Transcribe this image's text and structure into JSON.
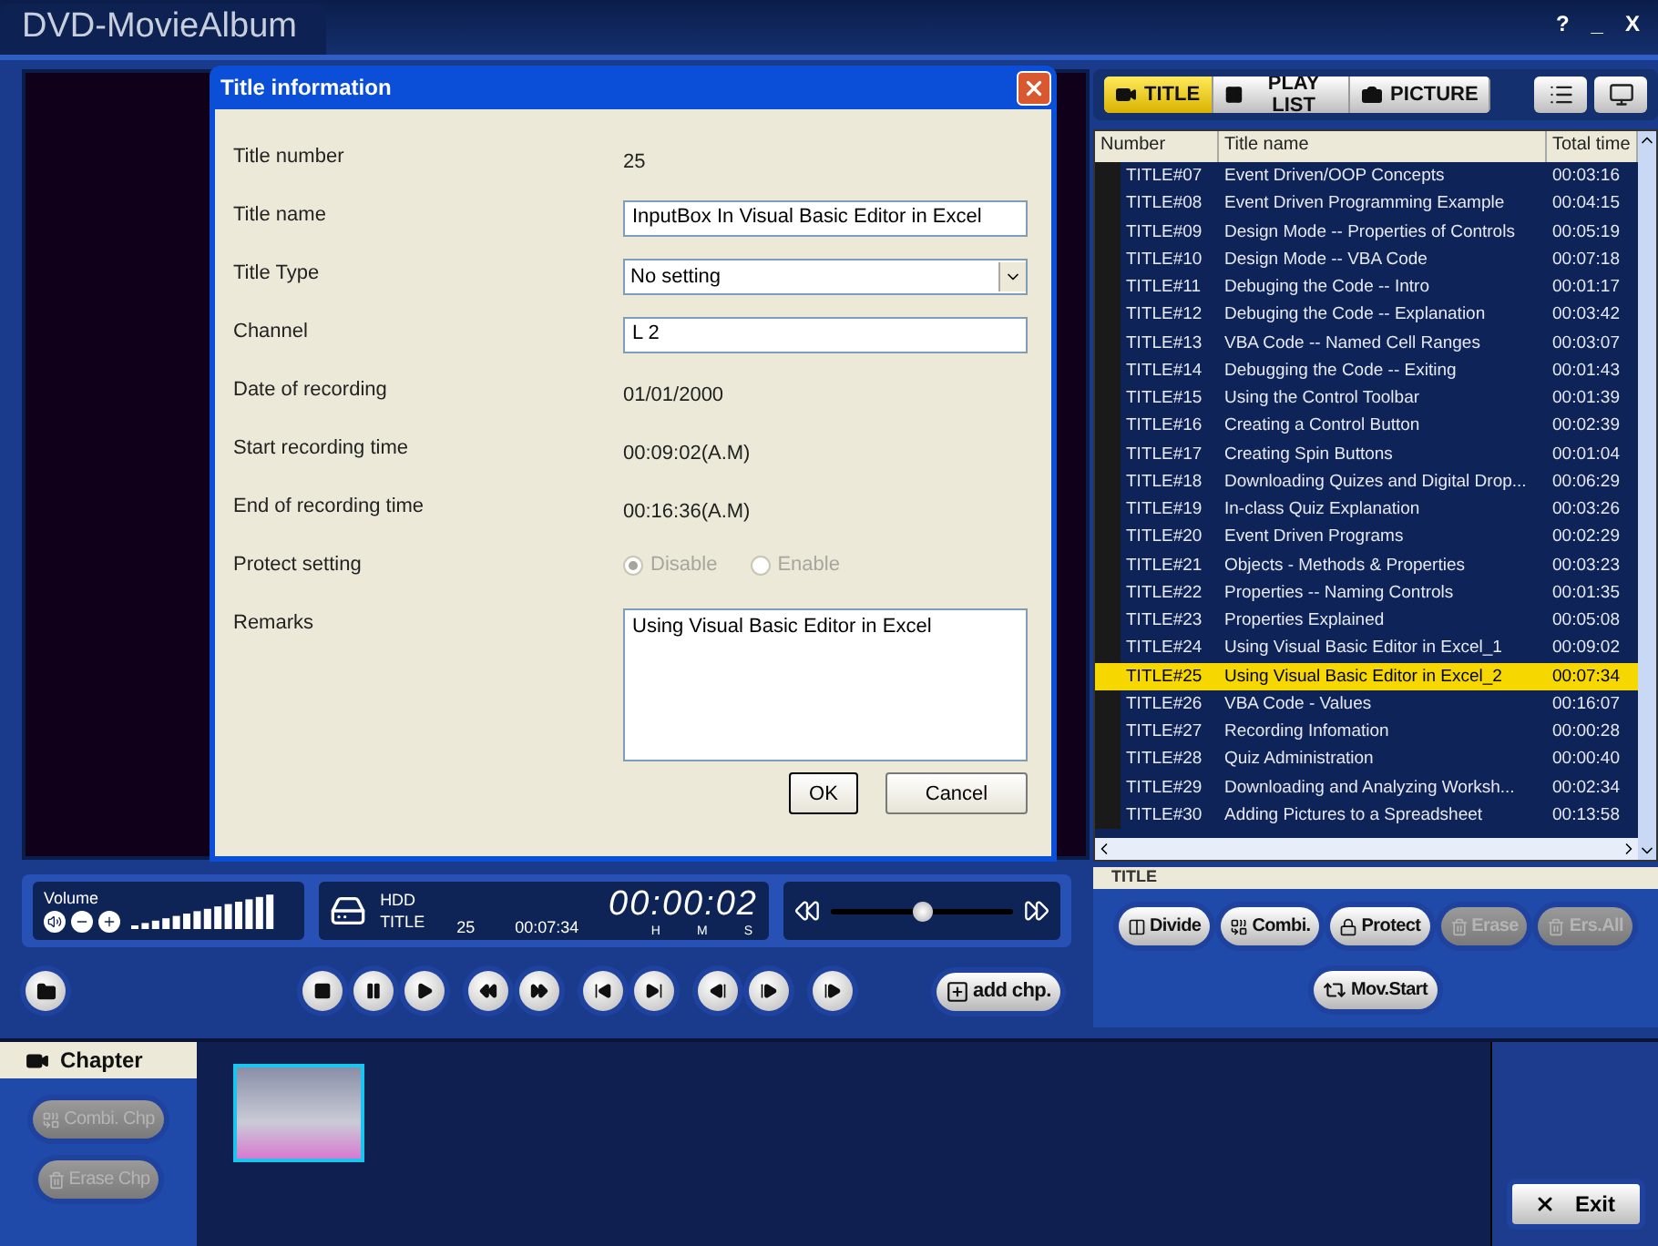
{
  "app": {
    "title": "DVD-MovieAlbum",
    "controls": [
      "?",
      "_",
      "X"
    ]
  },
  "dialog": {
    "title": "Title information",
    "fields": [
      {
        "kind": "text",
        "label": "Title number",
        "value": "25"
      },
      {
        "kind": "input",
        "label": "Title name",
        "value": "InputBox In Visual Basic Editor in Excel"
      },
      {
        "kind": "select",
        "label": "Title Type",
        "value": "No setting"
      },
      {
        "kind": "input",
        "label": "Channel",
        "value": "L 2"
      },
      {
        "kind": "text",
        "label": "Date of recording",
        "value": "01/01/2000"
      },
      {
        "kind": "text",
        "label": "Start recording time",
        "value": "00:09:02(A.M)"
      },
      {
        "kind": "text",
        "label": "End of recording time",
        "value": "00:16:36(A.M)"
      },
      {
        "kind": "radio",
        "label": "Protect setting",
        "disabled": true,
        "options": [
          {
            "label": "Disable",
            "selected": true
          },
          {
            "label": "Enable",
            "selected": false
          }
        ]
      },
      {
        "kind": "textarea",
        "label": "Remarks",
        "value": "Using Visual Basic Editor in Excel"
      }
    ],
    "buttons": [
      "OK",
      "Cancel"
    ]
  },
  "volume": {
    "label": "Volume"
  },
  "display": {
    "source": "HDD",
    "title_label": "TITLE",
    "title_number": "25",
    "duration": "00:07:34",
    "time": "00:00:02",
    "units": [
      "H",
      "M",
      "S"
    ]
  },
  "seek": {
    "level": 0.5
  },
  "add_chapter_button": "add chp.",
  "tabs": [
    {
      "label": "TITLE",
      "selected": true
    },
    {
      "label": "PLAY LIST",
      "selected": false
    },
    {
      "label": "PICTURE",
      "selected": false
    }
  ],
  "table": {
    "columns": [
      "Number",
      "Title name",
      "Total time"
    ],
    "rows": [
      {
        "number": "TITLE#07",
        "name": "Event Driven/OOP Concepts",
        "time": "00:03:16",
        "selected": false
      },
      {
        "number": "TITLE#08",
        "name": "Event Driven Programming Example",
        "time": "00:04:15",
        "selected": false
      },
      {
        "number": "TITLE#09",
        "name": "Design Mode -- Properties of Controls",
        "time": "00:05:19",
        "selected": false
      },
      {
        "number": "TITLE#10",
        "name": "Design Mode -- VBA Code",
        "time": "00:07:18",
        "selected": false
      },
      {
        "number": "TITLE#11",
        "name": "Debuging the Code -- Intro",
        "time": "00:01:17",
        "selected": false
      },
      {
        "number": "TITLE#12",
        "name": "Debuging the Code -- Explanation",
        "time": "00:03:42",
        "selected": false
      },
      {
        "number": "TITLE#13",
        "name": "VBA Code -- Named Cell Ranges",
        "time": "00:03:07",
        "selected": false
      },
      {
        "number": "TITLE#14",
        "name": "Debugging the Code -- Exiting",
        "time": "00:01:43",
        "selected": false
      },
      {
        "number": "TITLE#15",
        "name": "Using the Control Toolbar",
        "time": "00:01:39",
        "selected": false
      },
      {
        "number": "TITLE#16",
        "name": "Creating a Control Button",
        "time": "00:02:39",
        "selected": false
      },
      {
        "number": "TITLE#17",
        "name": "Creating Spin Buttons",
        "time": "00:01:04",
        "selected": false
      },
      {
        "number": "TITLE#18",
        "name": "Downloading Quizes and Digital Drop...",
        "time": "00:06:29",
        "selected": false
      },
      {
        "number": "TITLE#19",
        "name": "In-class Quiz Explanation",
        "time": "00:03:26",
        "selected": false
      },
      {
        "number": "TITLE#20",
        "name": "Event Driven Programs",
        "time": "00:02:29",
        "selected": false
      },
      {
        "number": "TITLE#21",
        "name": "Objects - Methods & Properties",
        "time": "00:03:23",
        "selected": false
      },
      {
        "number": "TITLE#22",
        "name": "Properties -- Naming Controls",
        "time": "00:01:35",
        "selected": false
      },
      {
        "number": "TITLE#23",
        "name": "Properties Explained",
        "time": "00:05:08",
        "selected": false
      },
      {
        "number": "TITLE#24",
        "name": "Using Visual Basic Editor in Excel_1",
        "time": "00:09:02",
        "selected": false
      },
      {
        "number": "TITLE#25",
        "name": "Using Visual Basic Editor in Excel_2",
        "time": "00:07:34",
        "selected": true
      },
      {
        "number": "TITLE#26",
        "name": "VBA Code - Values",
        "time": "00:16:07",
        "selected": false
      },
      {
        "number": "TITLE#27",
        "name": "Recording Infomation",
        "time": "00:00:28",
        "selected": false
      },
      {
        "number": "TITLE#28",
        "name": "Quiz Administration",
        "time": "00:00:40",
        "selected": false
      },
      {
        "number": "TITLE#29",
        "name": "Downloading and Analyzing Worksh...",
        "time": "00:02:34",
        "selected": false
      },
      {
        "number": "TITLE#30",
        "name": "Adding Pictures to a Spreadsheet",
        "time": "00:13:58",
        "selected": false
      }
    ]
  },
  "panel_caption": "TITLE",
  "title_buttons": [
    {
      "label": "Divide",
      "disabled": false
    },
    {
      "label": "Combi.",
      "disabled": false
    },
    {
      "label": "Protect",
      "disabled": false
    },
    {
      "label": "Erase",
      "disabled": true
    },
    {
      "label": "Ers.All",
      "disabled": true
    }
  ],
  "move_button": "Mov.Start",
  "chapter": {
    "heading": "Chapter",
    "buttons": [
      {
        "label": "Combi. Chp",
        "disabled": true
      },
      {
        "label": "Erase Chp",
        "disabled": true
      }
    ]
  },
  "exit_button": "Exit"
}
